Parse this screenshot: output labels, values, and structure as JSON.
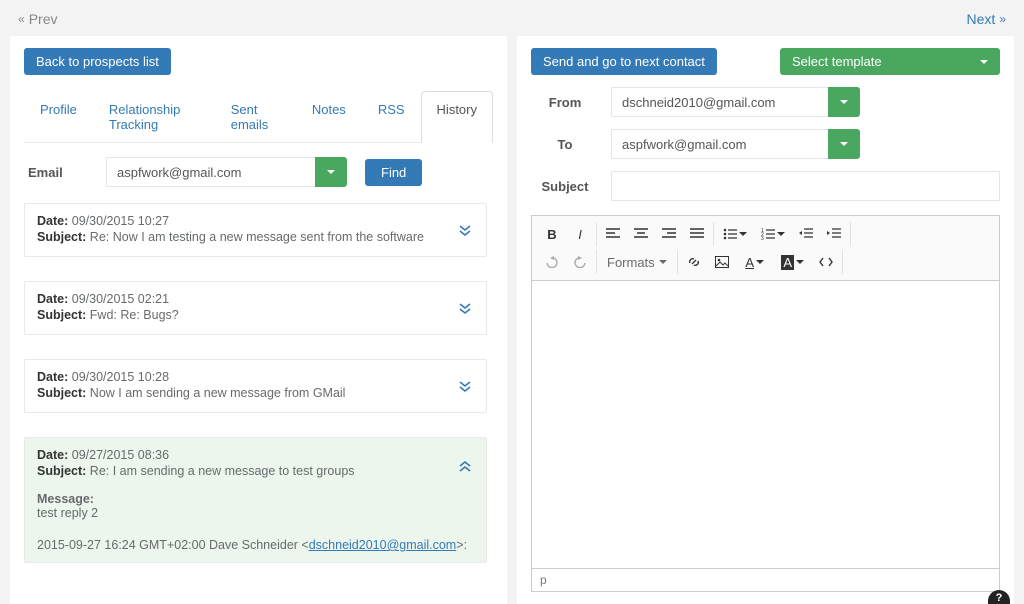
{
  "nav": {
    "prev": "Prev",
    "next": "Next"
  },
  "left": {
    "back_btn": "Back to prospects list",
    "tabs": [
      "Profile",
      "Relationship Tracking",
      "Sent emails",
      "Notes",
      "RSS",
      "History"
    ],
    "email_label": "Email",
    "email_value": "aspfwork@gmail.com",
    "find_btn": "Find",
    "history": [
      {
        "date": "09/30/2015 10:27",
        "subject": "Re: Now I am testing a new message sent from the software",
        "expanded": false
      },
      {
        "date": "09/30/2015 02:21",
        "subject": "Fwd: Re: Bugs?",
        "expanded": false
      },
      {
        "date": "09/30/2015 10:28",
        "subject": "Now I am sending a new message from GMail",
        "expanded": false
      },
      {
        "date": "09/27/2015 08:36",
        "subject": "Re: I am sending a new message to test groups",
        "expanded": true,
        "message_label": "Message:",
        "message_body": "test reply 2",
        "quote_prefix": "2015-09-27 16:24 GMT+02:00 Dave Schneider <",
        "quote_email": "dschneid2010@gmail.com",
        "quote_suffix": ">:"
      }
    ],
    "labels": {
      "date": "Date:",
      "subject": "Subject:"
    }
  },
  "right": {
    "send_btn": "Send and go to next contact",
    "template_btn": "Select template",
    "from_label": "From",
    "from_value": "dschneid2010@gmail.com",
    "to_label": "To",
    "to_value": "aspfwork@gmail.com",
    "subject_label": "Subject",
    "subject_value": "",
    "formats_label": "Formats",
    "status": "p"
  }
}
